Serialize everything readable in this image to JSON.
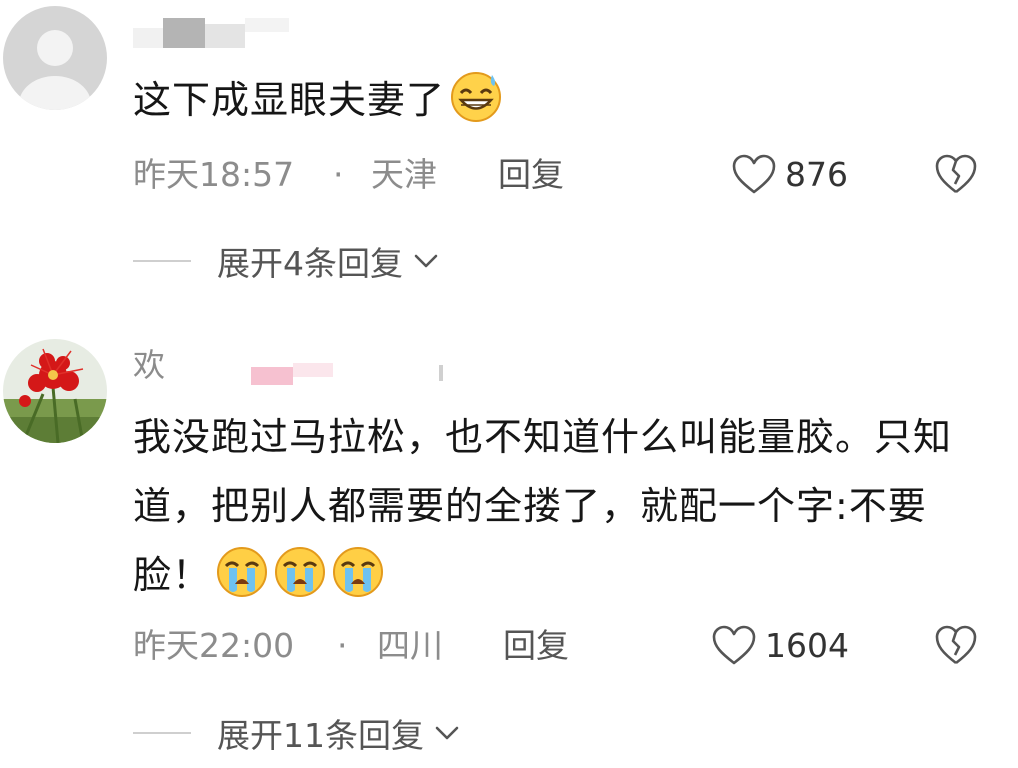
{
  "comments": [
    {
      "username": "",
      "text": "这下成显眼夫妻了",
      "emojis": [
        "grinning-sweat-emoji"
      ],
      "time": "昨天18:57",
      "separator": "·",
      "location": "天津",
      "reply_label": "回复",
      "likes": "876",
      "expand_label": "展开4条回复"
    },
    {
      "username": "欢",
      "text": "我没跑过马拉松，也不知道什么叫能量胶。只知道，把别人都需要的全搂了，就配一个字:不要脸！",
      "emojis": [
        "crying-emoji",
        "crying-emoji",
        "crying-emoji"
      ],
      "time": "昨天22:00",
      "separator": "·",
      "location": "四川",
      "reply_label": "回复",
      "likes": "1604",
      "expand_label": "展开11条回复"
    }
  ],
  "colors": {
    "text": "#161616",
    "meta": "#8c8c8c",
    "accent_reply": "#555555"
  },
  "icons": {
    "like": "heart-outline-icon",
    "dislike": "broken-heart-icon",
    "expand": "chevron-down-icon"
  }
}
